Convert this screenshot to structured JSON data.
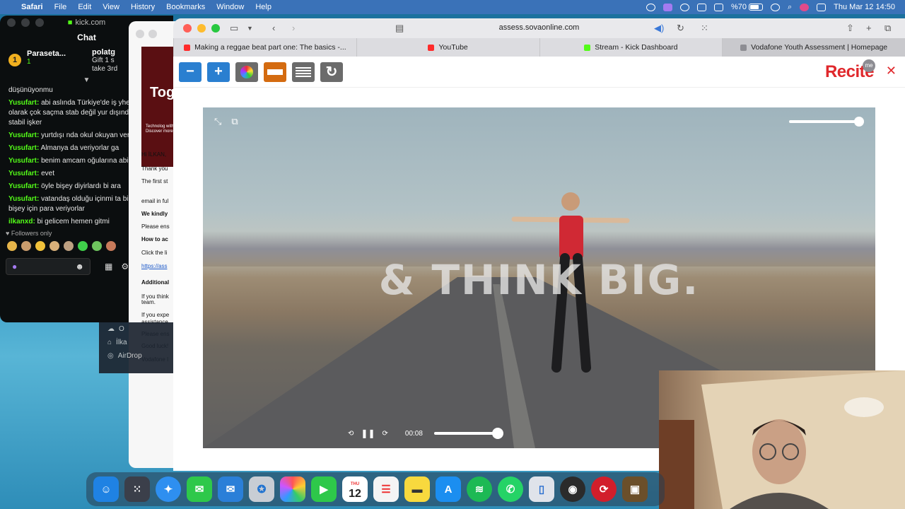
{
  "menubar": {
    "app_name": "Safari",
    "items": [
      "File",
      "Edit",
      "View",
      "History",
      "Bookmarks",
      "Window",
      "Help"
    ],
    "battery_pct": "%70",
    "battery_level": 0.7,
    "clock": "Thu Mar 12  14:50"
  },
  "kick": {
    "window_title": "kick.com",
    "chat_header": "Chat",
    "pinned": {
      "name": "Paraseta...",
      "sub": "1",
      "badge": "1",
      "gift_user": "polatg",
      "gift_text1": "Gift 1 s",
      "gift_text2": "take 3rd"
    },
    "messages": [
      {
        "user": "",
        "text": "düşünüyonmu"
      },
      {
        "user": "Yusufart:",
        "text": "abi aslında Türkiye'de iş yhespsi genel olarak çok saçma stab değil yur dışında flanş stabil işker"
      },
      {
        "user": "Yusufart:",
        "text": "yurtdışı nda okul okuyan veriyorlar"
      },
      {
        "user": "Yusufart:",
        "text": "Almanya da veriyorlar ga"
      },
      {
        "user": "Yusufart:",
        "text": "benim amcam oğularına abi"
      },
      {
        "user": "Yusufart:",
        "text": "evet"
      },
      {
        "user": "Yusufart:",
        "text": "öyle bişey diyirlardı bi ara"
      },
      {
        "user": "Yusufart:",
        "text": "vatandaş olduğu içinmi ta bilmiyom bişey için para veriyorlar"
      },
      {
        "user": "ilkanxd:",
        "text": "bi gelicem hemen gitmi"
      }
    ],
    "followers_only": "Followers only"
  },
  "mail": {
    "hero_title": "Tog",
    "hero_sub": "Technolog without h Discover more at",
    "lines": [
      "Hi İLKAN,",
      "Thank you",
      "The first st",
      "email in ful",
      "We kindly",
      "Please ens",
      "How to ac",
      "Click the li",
      "https://ass",
      "Additional",
      "If you think",
      "team.",
      "If you expe",
      "assistance",
      "Please ens",
      "Good luck!",
      "Vodafone I"
    ]
  },
  "finder": {
    "items": [
      "O",
      "İlka",
      "AirDrop"
    ]
  },
  "safari": {
    "url": "assess.sovaonline.com",
    "tabs": [
      {
        "label": "Making a reggae beat part one: The basics -...",
        "color": "#ff2b2b"
      },
      {
        "label": "YouTube",
        "color": "#ff2b2b"
      },
      {
        "label": "Stream - Kick Dashboard",
        "color": "#53fc18"
      },
      {
        "label": "Vodafone Youth Assessment | Homepage",
        "color": "#8d8d93"
      }
    ]
  },
  "recite": {
    "logo": "Recite",
    "me": "me",
    "buttons": [
      {
        "name": "decrease-button",
        "glyph": "−",
        "color": "#2a7fd0"
      },
      {
        "name": "increase-button",
        "glyph": "+",
        "color": "#2a7fd0"
      },
      {
        "name": "color-wheel-button",
        "glyph": "",
        "color": "#6b6b6b"
      },
      {
        "name": "ruler-button",
        "glyph": "",
        "color": "#d46b10"
      },
      {
        "name": "text-mode-button",
        "glyph": "",
        "color": "#6b6b6b"
      },
      {
        "name": "reset-button",
        "glyph": "↻",
        "color": "#6b6b6b"
      }
    ]
  },
  "video": {
    "overlay_text": "& THINK BIG.",
    "time": "00:08",
    "volume_level": 1.0,
    "progress_level": 0.12
  },
  "dock": {
    "calendar_day": "12",
    "calendar_month": "THU"
  }
}
